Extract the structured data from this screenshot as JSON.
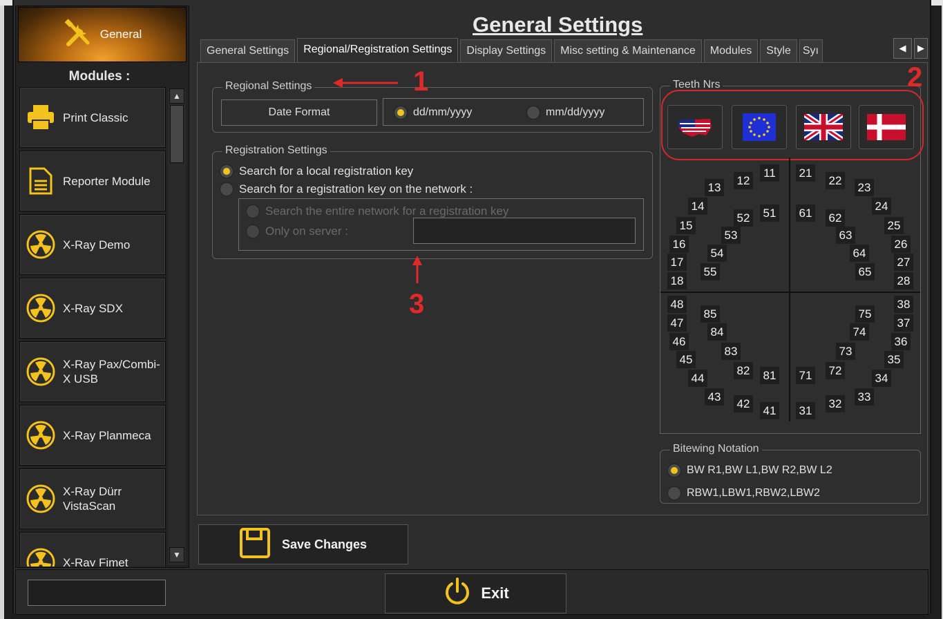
{
  "colors": {
    "accent": "#f4c21c",
    "annotation": "#e02a2a"
  },
  "sidebar": {
    "general_label": "General",
    "modules_title": "Modules :",
    "items": [
      {
        "label": "Print Classic",
        "icon": "printer-icon"
      },
      {
        "label": "Reporter Module",
        "icon": "document-icon"
      },
      {
        "label": "X-Ray Demo",
        "icon": "radiation-icon"
      },
      {
        "label": "X-Ray SDX",
        "icon": "radiation-icon"
      },
      {
        "label": "X-Ray Pax/Combi-\nX USB",
        "icon": "radiation-icon"
      },
      {
        "label": "X-Ray Planmeca",
        "icon": "radiation-icon"
      },
      {
        "label": "X-Ray Dürr\nVistaScan",
        "icon": "radiation-icon"
      },
      {
        "label": "X-Ray Fimet",
        "icon": "radiation-icon"
      }
    ]
  },
  "header": {
    "title": "General Settings"
  },
  "tabs": [
    {
      "label": "General Settings"
    },
    {
      "label": "Regional/Registration Settings"
    },
    {
      "label": "Display Settings"
    },
    {
      "label": "Misc setting & Maintenance"
    },
    {
      "label": "Modules"
    },
    {
      "label": "Style"
    },
    {
      "label": "Syı"
    }
  ],
  "regional": {
    "legend": "Regional Settings",
    "date_format_label": "Date Format",
    "options": [
      "dd/mm/yyyy",
      "mm/dd/yyyy"
    ],
    "selected": "dd/mm/yyyy"
  },
  "registration": {
    "legend": "Registration Settings",
    "local": "Search for a local registration key",
    "network": "Search for a registration key on the network :",
    "entire": "Search the entire network for a registration key",
    "server": "Only on server :",
    "server_value": ""
  },
  "teeth": {
    "legend": "Teeth Nrs",
    "flags": [
      "us-flag-icon",
      "eu-flag-icon",
      "uk-flag-icon",
      "denmark-flag-icon"
    ],
    "numbers": [
      "11",
      "12",
      "13",
      "14",
      "15",
      "16",
      "17",
      "18",
      "21",
      "22",
      "23",
      "24",
      "25",
      "26",
      "27",
      "28",
      "51",
      "52",
      "53",
      "54",
      "55",
      "61",
      "62",
      "63",
      "64",
      "65",
      "48",
      "47",
      "46",
      "45",
      "44",
      "43",
      "42",
      "41",
      "85",
      "84",
      "83",
      "82",
      "81",
      "31",
      "32",
      "33",
      "34",
      "35",
      "36",
      "37",
      "38",
      "71",
      "72",
      "73",
      "74",
      "75"
    ]
  },
  "bitewing": {
    "legend": "Bitewing Notation",
    "options": [
      "BW R1,BW L1,BW R2,BW L2",
      "RBW1,LBW1,RBW2,LBW2"
    ],
    "selected": "BW R1,BW L1,BW R2,BW L2"
  },
  "annotations": [
    "1",
    "2",
    "3"
  ],
  "buttons": {
    "save": "Save Changes",
    "exit": "Exit"
  },
  "bottom_input": ""
}
